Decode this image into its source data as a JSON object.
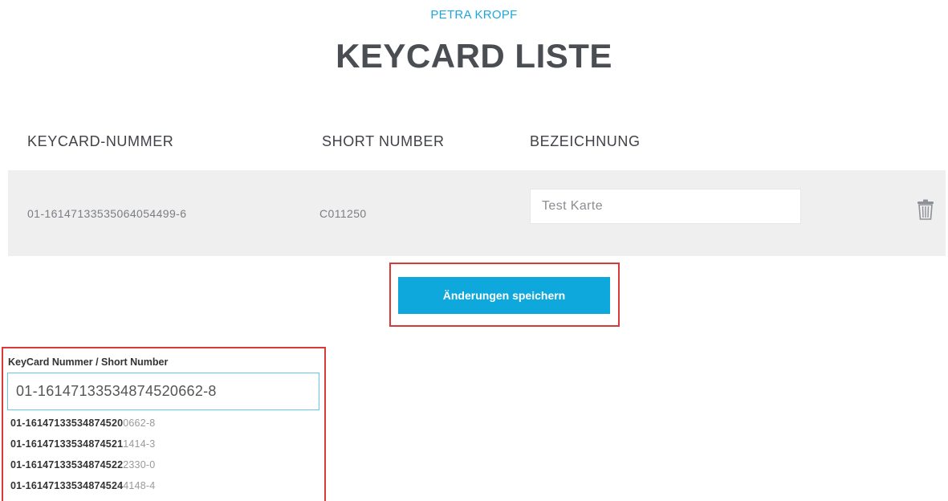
{
  "header": {
    "user_name": "PETRA KROPF",
    "title": "KEYCARD LISTE"
  },
  "table": {
    "columns": [
      "KEYCARD-NUMMER",
      "SHORT NUMBER",
      "BEZEICHNUNG"
    ],
    "rows": [
      {
        "keycard_number": "01-16147133535064054499-6",
        "short_number": "C011250",
        "description": "Test Karte"
      }
    ]
  },
  "actions": {
    "save_label": "Änderungen speichern"
  },
  "search": {
    "label": "KeyCard Nummer / Short Number",
    "value": "01-16147133534874520662-8",
    "suggestions": [
      {
        "match": "01-16147133534874520",
        "rest": "0662-8"
      },
      {
        "match": "01-16147133534874521",
        "rest": "1414-3"
      },
      {
        "match": "01-16147133534874522",
        "rest": "2330-0"
      },
      {
        "match": "01-16147133534874524",
        "rest": "4148-4"
      }
    ]
  },
  "icons": {
    "delete": "trash-icon"
  },
  "colors": {
    "accent": "#0ea8dc",
    "highlight": "#d83a3a",
    "row_background": "#efefef"
  }
}
